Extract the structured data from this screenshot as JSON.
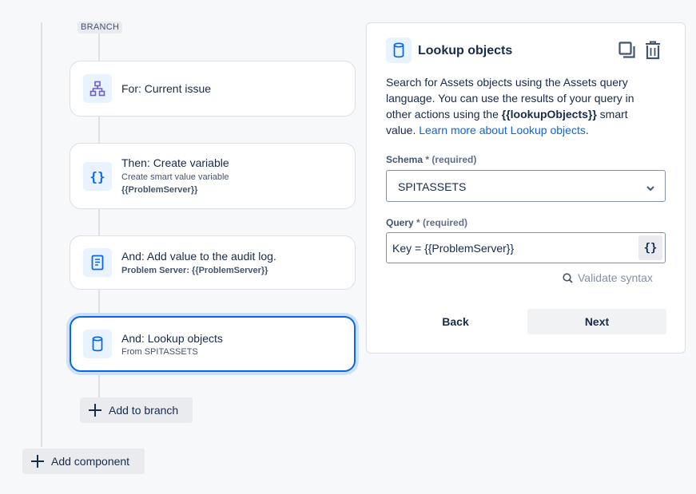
{
  "branch": {
    "chip": "BRANCH"
  },
  "steps": [
    {
      "title": "For: Current issue",
      "icon": "branch-icon"
    },
    {
      "title": "Then: Create variable",
      "subtitle": "Create smart value variable",
      "detail": "{{ProblemServer}}",
      "icon": "curly-braces-icon"
    },
    {
      "title": "And: Add value to the audit log.",
      "detail": "Problem Server: {{ProblemServer}}",
      "icon": "audit-log-icon"
    },
    {
      "title": "And: Lookup objects",
      "subtitle": "From SPITASSETS",
      "icon": "database-icon"
    }
  ],
  "add_to_branch_label": "Add to branch",
  "add_component_label": "Add component",
  "panel": {
    "title": "Lookup objects",
    "desc_part1": "Search for Assets objects using the Assets query language. You can use the results of your query in other actions using the ",
    "desc_bold": "{{lookupObjects}}",
    "desc_part2": " smart value. ",
    "desc_link": "Learn more about Lookup objects",
    "desc_end": ".",
    "schema_label": "Schema",
    "schema_req": "* (required)",
    "schema_value": "SPITASSETS",
    "query_label": "Query",
    "query_req": "* (required)",
    "query_value": "Key = {{ProblemServer}}",
    "smart_value_button": "{}",
    "validate_label": "Validate syntax",
    "back_label": "Back",
    "next_label": "Next"
  },
  "colors": {
    "accent": "#0c66e4",
    "icon_bg": "#e9f2ff",
    "purple_icon": "#6e5dc6"
  }
}
